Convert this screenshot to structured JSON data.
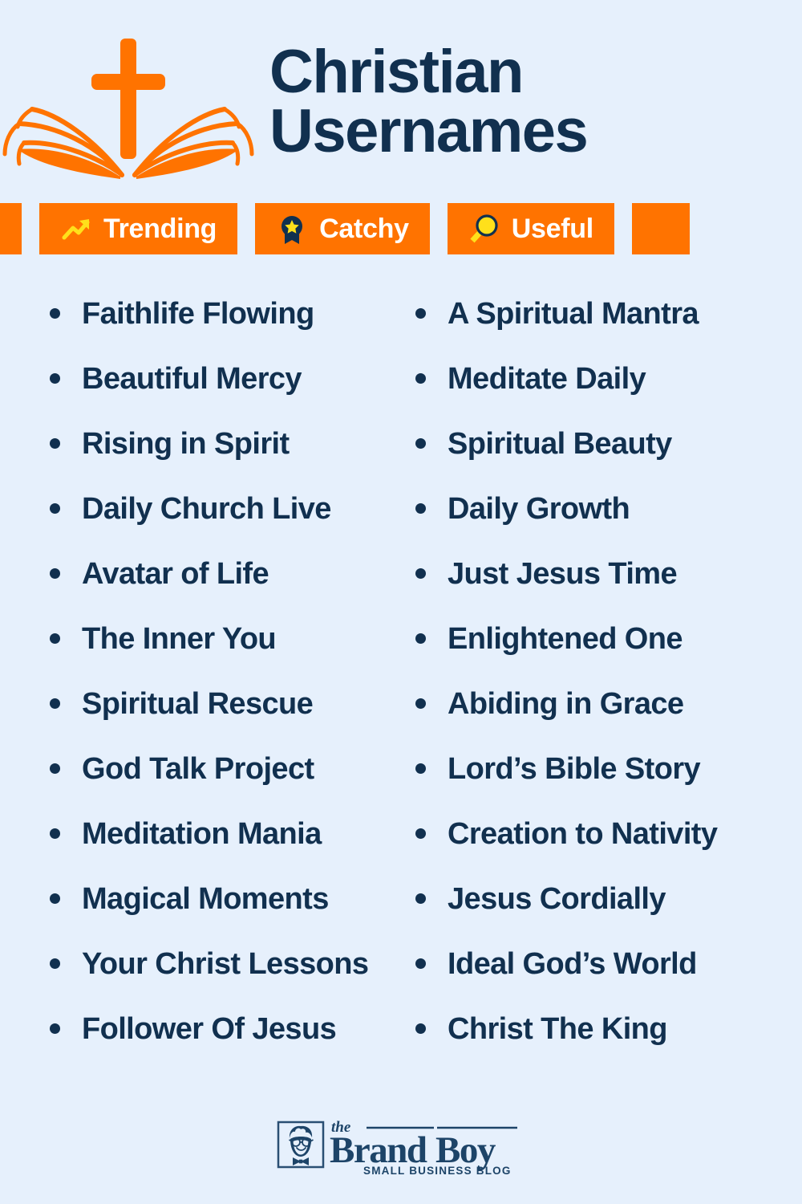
{
  "header": {
    "title_line1": "Christian",
    "title_line2": "Usernames",
    "logo_icon": "cross-open-book-icon"
  },
  "badges": [
    {
      "label": "Trending",
      "icon": "trending-up-icon"
    },
    {
      "label": "Catchy",
      "icon": "award-ribbon-star-icon"
    },
    {
      "label": "Useful",
      "icon": "magnifying-glass-icon"
    }
  ],
  "columns": {
    "left": [
      "Faithlife Flowing",
      "Beautiful Mercy",
      "Rising in Spirit",
      "Daily Church Live",
      "Avatar of Life",
      "The Inner You",
      "Spiritual Rescue",
      "God Talk Project",
      "Meditation Mania",
      "Magical Moments",
      "Your Christ Lessons",
      "Follower Of Jesus"
    ],
    "right": [
      "A Spiritual Mantra",
      "Meditate Daily",
      "Spiritual Beauty",
      "Daily Growth",
      "Just Jesus Time",
      "Enlightened One",
      "Abiding in Grace",
      "Lord’s Bible Story",
      "Creation to Nativity",
      "Jesus Cordially",
      "Ideal God’s World",
      "Christ The King"
    ]
  },
  "footer": {
    "the": "the",
    "brand": "Brand",
    "boy": "Boy",
    "tagline": "SMALL BUSINESS BLOG",
    "icon": "brandboy-face-icon"
  },
  "colors": {
    "background": "#e6f0fc",
    "navy": "#11304f",
    "orange": "#ff7300",
    "yellow": "#ffe01b",
    "white": "#ffffff"
  }
}
